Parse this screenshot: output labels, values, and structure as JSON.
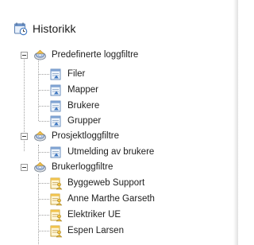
{
  "header": {
    "title": "Historikk",
    "icon": "calendar-history-icon"
  },
  "tree": {
    "groups": [
      {
        "label": "Predefinerte loggfiltre",
        "icon": "filter-group-icon",
        "expanded": true,
        "children": [
          {
            "label": "Filer",
            "icon": "log-document-icon"
          },
          {
            "label": "Mapper",
            "icon": "log-document-icon"
          },
          {
            "label": "Brukere",
            "icon": "log-document-icon"
          },
          {
            "label": "Grupper",
            "icon": "log-document-icon"
          }
        ]
      },
      {
        "label": "Prosjektloggfiltre",
        "icon": "filter-group-icon",
        "expanded": true,
        "children": [
          {
            "label": "Utmelding av brukere",
            "icon": "log-document-icon"
          }
        ]
      },
      {
        "label": "Brukerloggfiltre",
        "icon": "filter-group-icon",
        "expanded": true,
        "children": [
          {
            "label": "Byggeweb Support",
            "icon": "user-log-document-icon"
          },
          {
            "label": "Anne Marthe Garseth",
            "icon": "user-log-document-icon"
          },
          {
            "label": "Elektriker UE",
            "icon": "user-log-document-icon"
          },
          {
            "label": "Espen Larsen",
            "icon": "user-log-document-icon"
          }
        ]
      }
    ]
  }
}
